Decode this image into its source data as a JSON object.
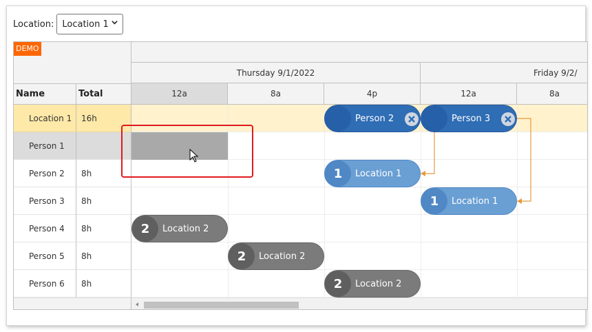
{
  "toolbar": {
    "location_label": "Location:",
    "location_value": "Location 1"
  },
  "scheduler": {
    "demo_badge": "DEMO",
    "columns": {
      "name": "Name",
      "total": "Total"
    },
    "days": [
      "Thursday 9/1/2022",
      "Friday 9/2/"
    ],
    "hours": [
      "12a",
      "8a",
      "4p",
      "12a",
      "8a"
    ],
    "rows": [
      {
        "name": "Location 1",
        "total": "16h"
      },
      {
        "name": "Person 1",
        "total": ""
      },
      {
        "name": "Person 2",
        "total": "8h"
      },
      {
        "name": "Person 3",
        "total": "8h"
      },
      {
        "name": "Person 4",
        "total": "8h"
      },
      {
        "name": "Person 5",
        "total": "8h"
      },
      {
        "name": "Person 6",
        "total": "8h"
      }
    ],
    "events": [
      {
        "text": "Person 2",
        "badge": ""
      },
      {
        "text": "Person 3",
        "badge": ""
      },
      {
        "text": "Location 1",
        "badge": "1"
      },
      {
        "text": "Location 1",
        "badge": "1"
      },
      {
        "text": "Location 2",
        "badge": "2"
      },
      {
        "text": "Location 2",
        "badge": "2"
      },
      {
        "text": "Location 2",
        "badge": "2"
      }
    ]
  },
  "colors": {
    "location_row": "#ffe9a8",
    "event_assigned": "#2f6db5",
    "event_location": "#6a9fd4",
    "event_other": "#7b7b7b",
    "link": "#e59a3c",
    "highlight": "#e0191e"
  }
}
